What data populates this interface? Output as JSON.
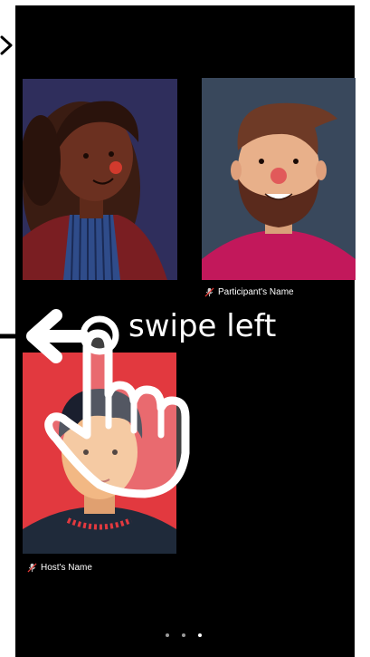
{
  "participants": [
    {
      "name": "",
      "muted": false,
      "avatar": "woman-avatar"
    },
    {
      "name": "Participant's Name",
      "muted": true,
      "avatar": "bearded-man-avatar"
    },
    {
      "name": "Host's Name",
      "muted": true,
      "avatar": "young-man-avatar"
    }
  ],
  "gesture_hint": {
    "text": "swipe left",
    "direction": "left",
    "icon": "swipe-left-hand-icon"
  },
  "pagination": {
    "total": 3,
    "current": 3
  },
  "colors": {
    "background": "#000000",
    "tile_woman": "#2f2e5c",
    "tile_man": "#39485c",
    "tile_host": "#e2393f",
    "label_text": "#ffffff"
  }
}
